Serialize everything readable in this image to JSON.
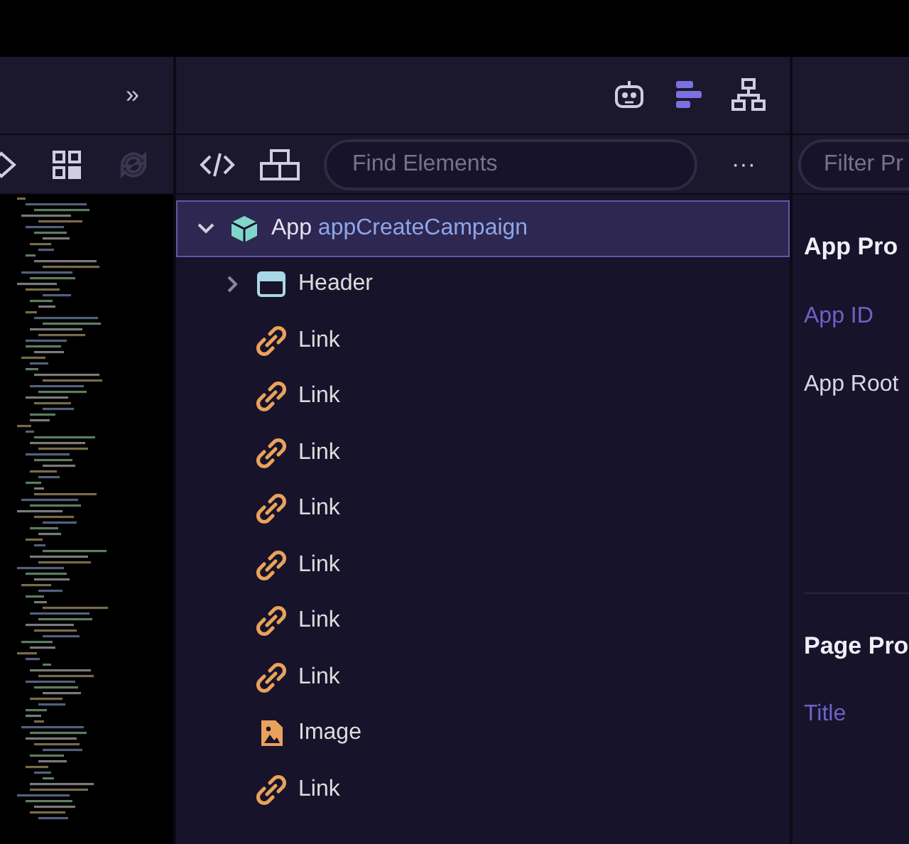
{
  "left_panel": {
    "collapse_glyph": "»",
    "refresh": {
      "disabled": true
    }
  },
  "middle_panel": {
    "views": [
      {
        "kind": "robot",
        "selected": false
      },
      {
        "kind": "outline",
        "selected": true
      },
      {
        "kind": "tree",
        "selected": false
      }
    ],
    "search": {
      "placeholder": "Find Elements"
    },
    "more_glyph": "···",
    "tree": {
      "kind": "app",
      "type": "App",
      "label": "appCreateCampaign",
      "selected": true,
      "expanded": true,
      "children": [
        {
          "kind": "header",
          "label": "Header",
          "expanded": false,
          "selected": false
        },
        {
          "kind": "link",
          "label": "Link",
          "selected": false
        },
        {
          "kind": "link",
          "label": "Link",
          "selected": false
        },
        {
          "kind": "link",
          "label": "Link",
          "selected": false
        },
        {
          "kind": "link",
          "label": "Link",
          "selected": false
        },
        {
          "kind": "link",
          "label": "Link",
          "selected": false
        },
        {
          "kind": "link",
          "label": "Link",
          "selected": false
        },
        {
          "kind": "link",
          "label": "Link",
          "selected": false
        },
        {
          "kind": "image",
          "label": "Image",
          "selected": false
        },
        {
          "kind": "link",
          "label": "Link",
          "selected": false
        }
      ]
    }
  },
  "right_panel": {
    "filter": {
      "placeholder": "Filter Pr"
    },
    "sections": [
      {
        "title": "App Pro",
        "fields": [
          {
            "label": "App ID",
            "kind": "link"
          },
          {
            "label": "App Root",
            "kind": "plain"
          }
        ]
      },
      {
        "title": "Page Pro",
        "fields": [
          {
            "label": "Title",
            "kind": "link"
          }
        ]
      }
    ]
  }
}
